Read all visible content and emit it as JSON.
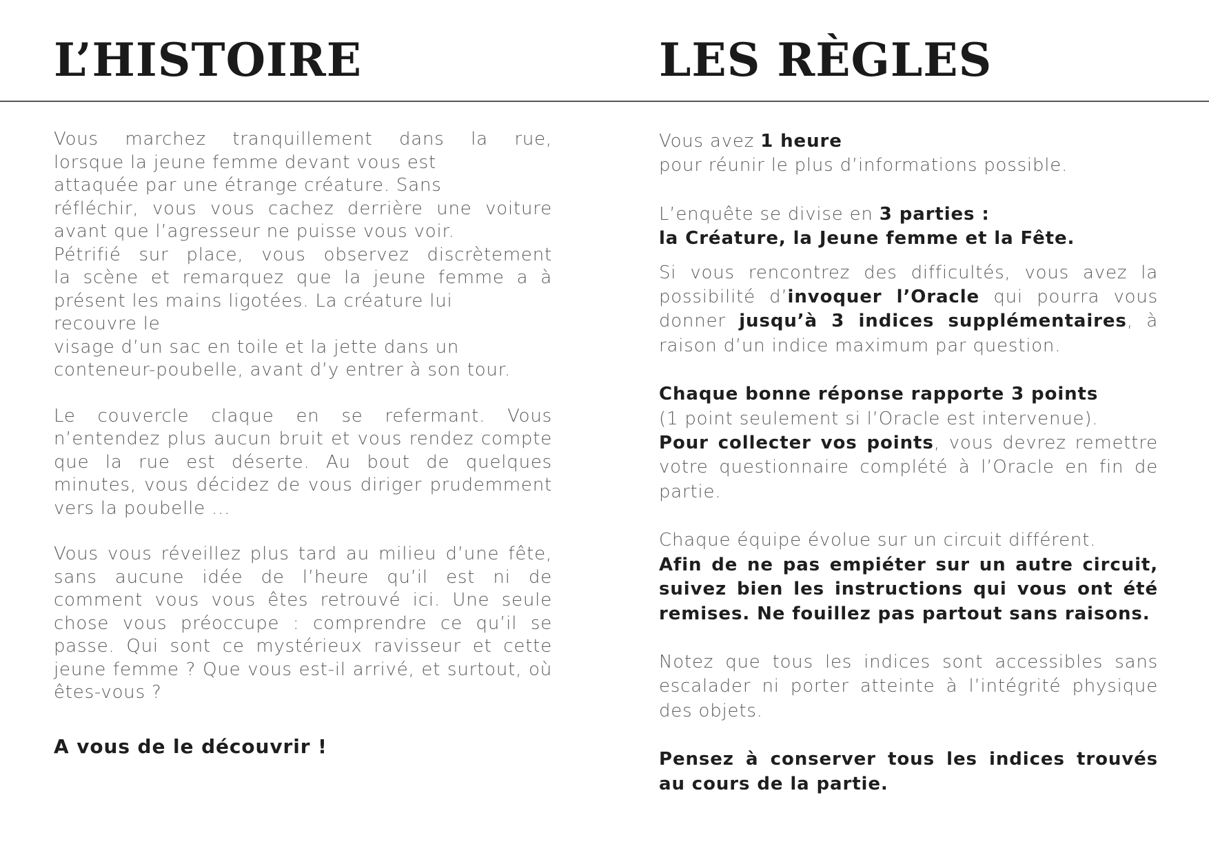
{
  "left": {
    "title": "L’HISTOIRE",
    "p1": {
      "l1": "Vous marchez tranquillement dans la rue,",
      "l2": "lorsque la jeune femme devant vous est",
      "l3": "attaquée par une étrange créature. Sans",
      "l4": "réfléchir, vous vous cachez derrière une voiture",
      "l5": "avant que l’agresseur ne puisse vous voir.",
      "l6": "Pétrifié sur place, vous observez discrètement",
      "l7": "la scène et remarquez que la jeune femme a à",
      "l8": "présent les mains ligotées. La créature lui",
      "l9": "recouvre le",
      "l10": "visage d’un sac en toile et la jette dans un",
      "l11": "conteneur-poubelle, avant d’y entrer à son tour."
    },
    "p2": "Le couvercle claque en se refermant. Vous n’entendez plus aucun bruit et vous rendez compte que la rue est déserte. Au bout de quelques minutes, vous décidez de vous diriger prudemment vers la poubelle ...",
    "p3": "Vous vous réveillez plus tard au milieu d’une fête, sans aucune idée de l’heure qu’il est ni de comment vous vous êtes retrouvé ici. Une seule chose vous préoccupe : comprendre ce qu’il se passe. Qui sont ce mystérieux ravisseur et cette jeune femme ?  Que vous est-il arrivé, et surtout, où êtes-vous ?",
    "closing": "A vous de le découvrir !"
  },
  "right": {
    "title": "LES RÈGLES",
    "time": {
      "a": "Vous avez ",
      "b": "1 heure",
      "c": " pour réunir le plus d’informations possible."
    },
    "parts": {
      "a": "L’enquête se divise en ",
      "b": "3 parties :",
      "c": "la Créature, la Jeune femme et la Fête."
    },
    "oracle": {
      "a": "Si vous rencontrez des difficultés, vous avez la possibilité d’",
      "b": "invoquer l’Oracle",
      "c": " qui pourra vous donner ",
      "d": "jusqu’à 3 indices supplémentaires",
      "e": ", à raison d’un indice maximum par question."
    },
    "points": {
      "a": "Chaque bonne réponse rapporte 3 points",
      "b": "(1 point seulement si l’Oracle est intervenue).",
      "c": "Pour collecter vos points",
      "d": ", vous devrez remettre votre questionnaire complété à l’Oracle en fin de partie."
    },
    "circuit": {
      "a": "Chaque équipe évolue sur un circuit différent.",
      "b": "Afin de ne pas empiéter sur un autre circuit, suivez bien les instructions qui vous ont été remises. Ne fouillez pas partout sans raisons."
    },
    "access": "Notez que tous les indices sont accessibles sans escalader ni porter atteinte à l’intégrité physique des objets.",
    "keep": "Pensez à conserver tous les indices trouvés au cours de la partie."
  }
}
